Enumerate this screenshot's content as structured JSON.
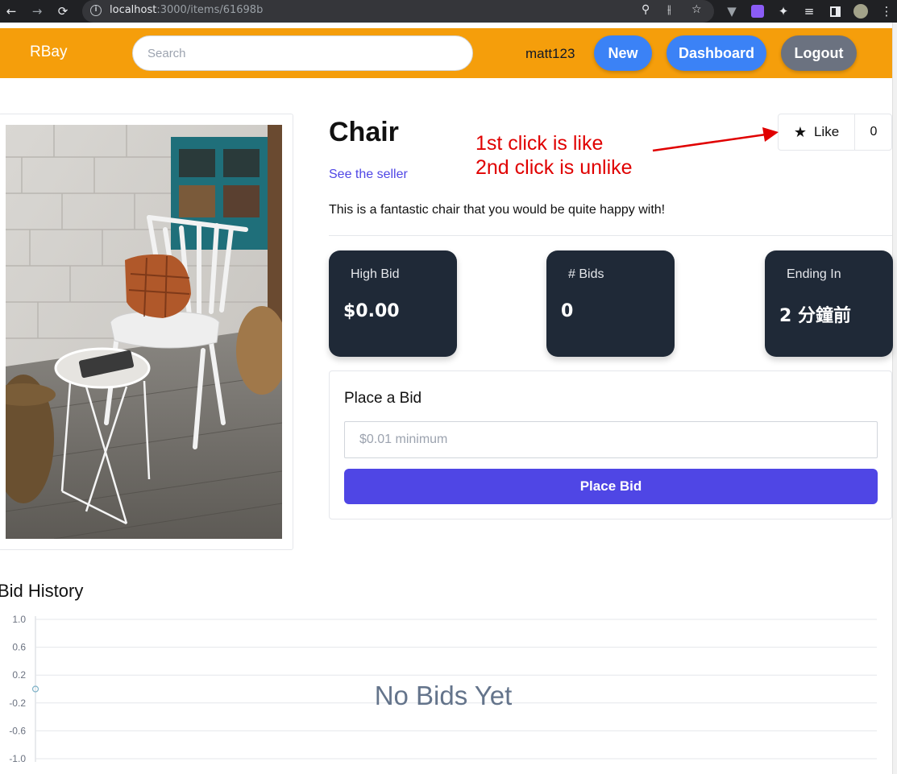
{
  "browser": {
    "url_host": "localhost",
    "url_rest": ":3000/items/61698b",
    "icons": [
      "back-icon",
      "forward-icon",
      "reload-icon",
      "info-icon",
      "zoom-icon",
      "share-icon",
      "bookmark-star-icon",
      "extension-icons",
      "menu-icon"
    ]
  },
  "navbar": {
    "brand": "RBay",
    "search_placeholder": "Search",
    "username": "matt123",
    "new_label": "New",
    "dashboard_label": "Dashboard",
    "logout_label": "Logout",
    "color": "#f59e0b"
  },
  "item": {
    "title": "Chair",
    "seller_link": "See the seller",
    "description": "This is a fantastic chair that you would be quite happy with!",
    "like_label": "Like",
    "like_count": "0"
  },
  "annotation": {
    "line1": "1st click is like",
    "line2": "2nd click is unlike",
    "color": "#e00000"
  },
  "stats": [
    {
      "label": "High Bid",
      "value": "$0.00"
    },
    {
      "label": "# Bids",
      "value": "0"
    },
    {
      "label": "Ending In",
      "value": "2 分鐘前"
    }
  ],
  "bid": {
    "heading": "Place a Bid",
    "placeholder": "$0.01 minimum",
    "button": "Place Bid",
    "button_color": "#4f46e5"
  },
  "history": {
    "title": "Bid History",
    "empty_message": "No Bids Yet"
  },
  "chart_data": {
    "type": "line",
    "series": [
      {
        "values": [
          0
        ]
      }
    ],
    "x": [
      0
    ],
    "yticks": [
      "1.0",
      "0.6",
      "0.2",
      "-0.2",
      "-0.6",
      "-1.0"
    ],
    "ylim": [
      -1.0,
      1.0
    ],
    "grid": true
  }
}
